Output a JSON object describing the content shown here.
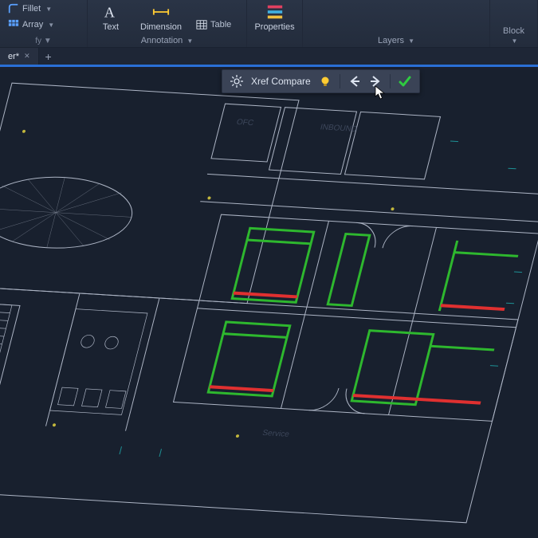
{
  "ribbon": {
    "modify": {
      "fillet": "Fillet",
      "array": "Array"
    },
    "annotation": {
      "label": "Annotation",
      "text": "Text",
      "dimension": "Dimension",
      "table": "Table"
    },
    "properties": {
      "btn": "Properties"
    },
    "layers": {
      "label": "Layers"
    },
    "block": {
      "label": "Block"
    }
  },
  "tabs": {
    "active_suffix": "er*",
    "close_glyph": "✕",
    "add_glyph": "+"
  },
  "xref": {
    "label": "Xref Compare"
  },
  "colors": {
    "accent": "#2a6fd6",
    "compare_add": "#2eb82e",
    "compare_del": "#e03030",
    "bulb": "#ffcc33",
    "check": "#2ecc40"
  }
}
